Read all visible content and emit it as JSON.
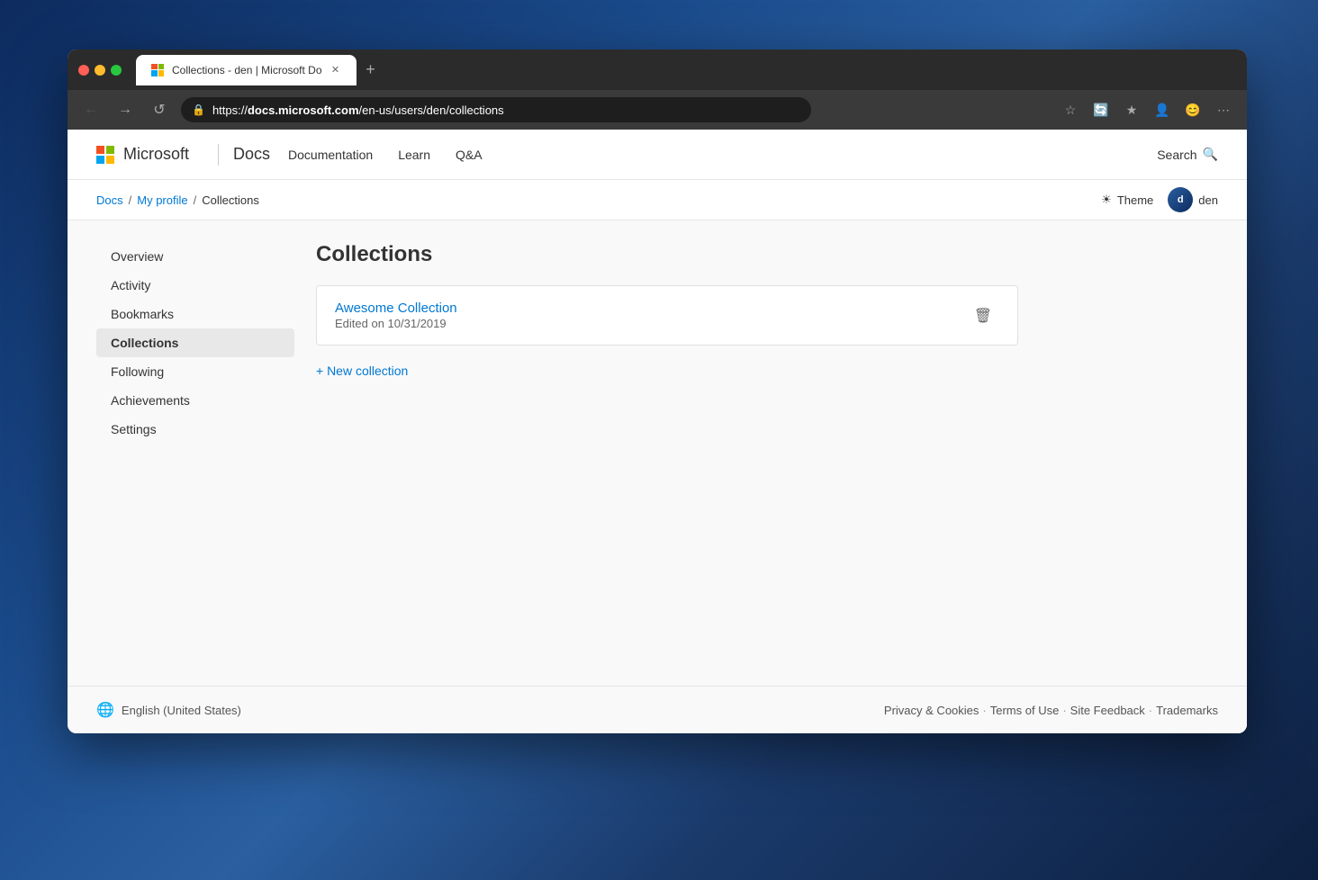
{
  "desktop": {
    "background": "city night skyline"
  },
  "browser": {
    "tab": {
      "title": "Collections - den | Microsoft Do",
      "url_display": "https://docs.microsoft.com/en-us/users/den/collections",
      "url_domain": "docs.microsoft.com",
      "url_path": "/en-us/users/den/collections"
    },
    "nav_buttons": {
      "back": "←",
      "forward": "→",
      "refresh": "↺"
    }
  },
  "top_nav": {
    "microsoft_label": "Microsoft",
    "docs_label": "Docs",
    "links": [
      {
        "label": "Documentation",
        "href": "#"
      },
      {
        "label": "Learn",
        "href": "#"
      },
      {
        "label": "Q&A",
        "href": "#"
      }
    ],
    "search_label": "Search",
    "theme_label": "Theme",
    "user_name": "den",
    "user_initials": "d"
  },
  "breadcrumb": {
    "items": [
      {
        "label": "Docs",
        "href": "#"
      },
      {
        "label": "My profile",
        "href": "#"
      },
      {
        "label": "Collections"
      }
    ]
  },
  "sidebar": {
    "items": [
      {
        "label": "Overview",
        "active": false,
        "id": "overview"
      },
      {
        "label": "Activity",
        "active": false,
        "id": "activity"
      },
      {
        "label": "Bookmarks",
        "active": false,
        "id": "bookmarks"
      },
      {
        "label": "Collections",
        "active": true,
        "id": "collections"
      },
      {
        "label": "Following",
        "active": false,
        "id": "following"
      },
      {
        "label": "Achievements",
        "active": false,
        "id": "achievements"
      },
      {
        "label": "Settings",
        "active": false,
        "id": "settings"
      }
    ]
  },
  "main": {
    "page_title": "Collections",
    "collections": [
      {
        "name": "Awesome Collection",
        "edited": "Edited on 10/31/2019"
      }
    ],
    "new_collection_label": "+ New collection"
  },
  "footer": {
    "language": "English (United States)",
    "links": [
      {
        "label": "Privacy & Cookies"
      },
      {
        "label": "Terms of Use"
      },
      {
        "label": "Site Feedback"
      },
      {
        "label": "Trademarks"
      }
    ]
  }
}
